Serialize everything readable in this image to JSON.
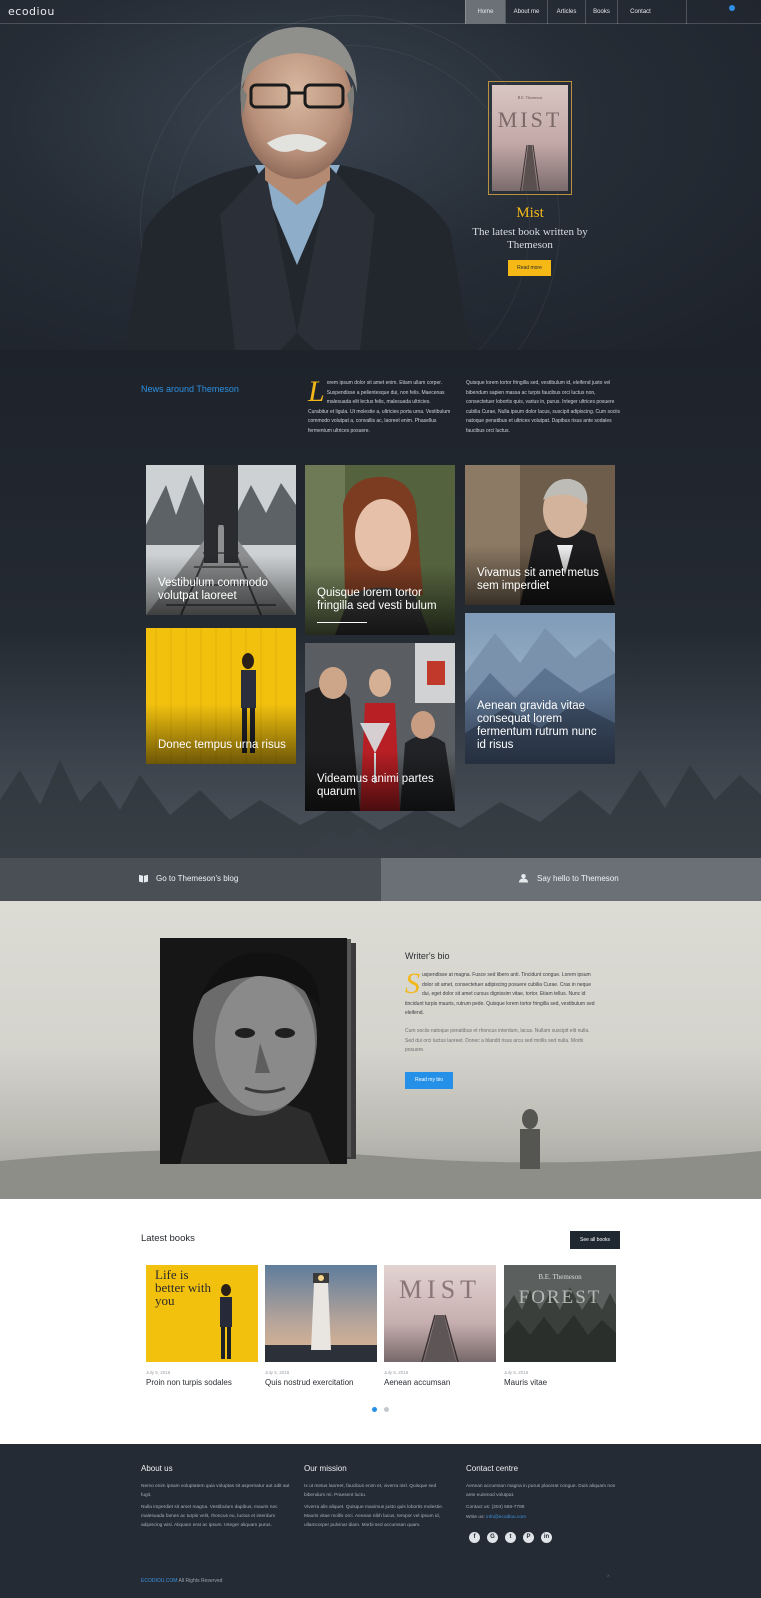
{
  "nav": {
    "logo": "ecodiou",
    "items": [
      {
        "label": "Home",
        "active": true
      },
      {
        "label": "About me",
        "active": false
      },
      {
        "label": "Articles",
        "active": false
      },
      {
        "label": "Books",
        "active": false
      },
      {
        "label": "Contact",
        "active": false
      }
    ]
  },
  "hero": {
    "book_cover_author": "B.E. Themeson",
    "book_cover_title": "MIST",
    "book_title": "Mist",
    "book_subtitle": "The latest book written by Themeson",
    "cta": "Read more"
  },
  "news": {
    "title": "News around Themeson",
    "p1_dropcap": "L",
    "p1": "orem ipsum dolor sit amet enim. Etiam ullam corper. Suspendisse a pellentesque dui, non felis. Maecenas malesuada elit lectus felis, malesuada ultricies. Curabitur et ligula. Ut molestie a, ultricies porta urna. Vestibulum commodo volutpat a, convallis ac, laoreet enim. Phasellus fermentum ultrices posuere.",
    "p2": "Quisque lorem tortor fringilla sed, vestibulum id, eleifend justo vel bibendum sapien massa ac turpis faucibus orci luctus non, consectetuer lobortis quis, varius in, purus. Integer ultrices posuere cubilia Curae, Nulla ipsum dolor lacus, suscipit adipiscing. Cum sociis natoque penatibus et ultrices volutpat. Dapibus risus ante sodales faucibus orci luctus.",
    "tiles": [
      {
        "caption": "Vestibulum commodo volutpat laoreet"
      },
      {
        "caption": "Quisque lorem tortor fringilla sed vesti bulum"
      },
      {
        "caption": "Vivamus sit amet metus sem imperdiet"
      },
      {
        "caption": "Donec tempus urna risus"
      },
      {
        "caption": "Videamus animi partes quarum"
      },
      {
        "caption": "Aenean gravida vitae consequat lorem fermentum rutrum nunc id risus"
      }
    ]
  },
  "cta_bar": {
    "blog": "Go to Themeson's blog",
    "hello": "Say hello to Themeson",
    "blog_icon": "book-icon",
    "hello_icon": "user-icon"
  },
  "bio": {
    "title": "Writer's bio",
    "p1_dropcap": "S",
    "p1": "uspendisse at magna. Fusce sed libero anti. Tincidunt congue. Lorem ipsum dolor sit amet, consectetuer adipiscing posuere cubilia Curae. Cras in neque dui, eget dolor sit amet cursus dignissim vitae, tortor. Etiam tellus. Nunc id tincidunt turpis mauris, rutrum pede. Quisque lorem tortor fringilla sed, vestibulum sed eleifend.",
    "p2": "Cum sociis natoque penatibus et rhoncus interdum, lacus. Nullam suscipit elit nulla. Sed dui orci luctus laoreet. Donec a blandit risus arcu sed mollis sed nulla. Morbi posuere.",
    "cta": "Read my bio"
  },
  "books": {
    "title": "Latest books",
    "see_all": "See all books",
    "items": [
      {
        "date": "July 5, 2016",
        "title": "Proin non turpis sodales",
        "cover_text": "Life is better with you"
      },
      {
        "date": "July 5, 2016",
        "title": "Quis nostrud exercitation"
      },
      {
        "date": "July 5, 2016",
        "title": "Aenean accumsan",
        "cover_text": "MIST"
      },
      {
        "date": "July 5, 2016",
        "title": "Mauris vitae",
        "cover_author": "B.E. Themeson",
        "cover_text": "FOREST"
      }
    ],
    "pager": [
      {
        "active": true
      },
      {
        "active": false
      }
    ]
  },
  "footer": {
    "about_title": "About us",
    "about_p1": "Nemo enim ipsam voluptatem quia voluptas sit aspernatur aut odit aut fugit.",
    "about_p2": "Nulla imperdiet sit amet magna. Vestibulum dapibus, mauris nec malesuada fames ac turpis velit, rhoncus eu, luctus et interdum adipiscing wisi. Aliquam erat ac ipsum. Integer aliquam purus.",
    "mission_title": "Our mission",
    "mission_p1": "Ix ut metus laoreet, faucibus enim et, viverra nisl. Quisque sed bibendum mi. Praesent luctu.",
    "mission_p2": "Viverra alis aliquet. Quisque maximus justo quis lobortis molestie. Mauris vitae mollis orci. Aenean nibh lacus, tempor vel ipsum id, ullamcorper pulvinar diam. Morbi sed accumsan quam.",
    "contact_title": "Contact centre",
    "contact_p1": "Aenean accumsan magna in purus placerat congue. Duis aliquam non ante euismod volutpat.",
    "contact_call_label": "Contact us:",
    "contact_phone": "(204) 566-7788",
    "contact_write_label": "Write us:",
    "contact_email": "info@ecodiou.com",
    "socials": [
      {
        "icon": "facebook-icon",
        "glyph": "f"
      },
      {
        "icon": "google-plus-icon",
        "glyph": "G"
      },
      {
        "icon": "twitter-icon",
        "glyph": "t"
      },
      {
        "icon": "pinterest-icon",
        "glyph": "P"
      },
      {
        "icon": "linkedin-icon",
        "glyph": "in"
      }
    ],
    "copyright_brand": "ECODIOU.COM",
    "copyright_rest": " All Rights Reserved",
    "to_top": "^"
  },
  "colors": {
    "accent_yellow": "#f5b815",
    "accent_blue": "#2590e8",
    "dark_bg": "#1e232b"
  }
}
